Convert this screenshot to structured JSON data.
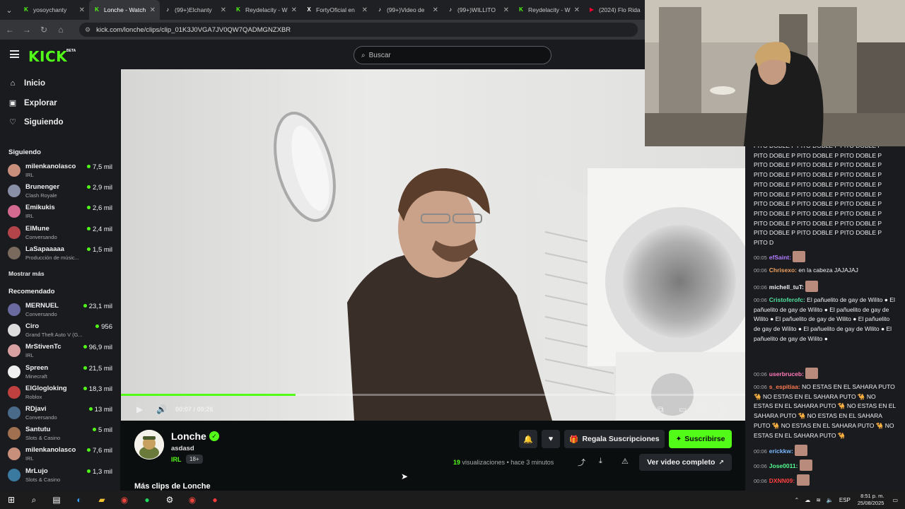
{
  "browser": {
    "tabs": [
      {
        "title": "yosoychanty",
        "fav": "K",
        "fav_color": "#53fc18",
        "active": false
      },
      {
        "title": "Lonche - Watch",
        "fav": "K",
        "fav_color": "#53fc18",
        "active": true
      },
      {
        "title": "(99+)Elchanty",
        "fav": "♪",
        "fav_color": "#ffffff",
        "active": false
      },
      {
        "title": "Reydelacity - W",
        "fav": "K",
        "fav_color": "#53fc18",
        "active": false
      },
      {
        "title": "FortyOficial en",
        "fav": "X",
        "fav_color": "#ffffff",
        "active": false
      },
      {
        "title": "(99+)Video de",
        "fav": "♪",
        "fav_color": "#ffffff",
        "active": false
      },
      {
        "title": "(99+)WILLITO",
        "fav": "♪",
        "fav_color": "#ffffff",
        "active": false
      },
      {
        "title": "Reydelacity - W",
        "fav": "K",
        "fav_color": "#53fc18",
        "active": false
      },
      {
        "title": "(2024) Flo Rida",
        "fav": "▶",
        "fav_color": "#ff0033",
        "active": false
      }
    ],
    "url": "kick.com/lonche/clips/clip_01K3J0VGA7JV0QW7QADMGNZXBR"
  },
  "header": {
    "logo": "KICK",
    "logo_badge": "BETA",
    "search_placeholder": "Buscar"
  },
  "sidebar": {
    "nav": [
      {
        "label": "Inicio",
        "icon": "home-icon",
        "glyph": "⌂"
      },
      {
        "label": "Explorar",
        "icon": "explore-icon",
        "glyph": "▣"
      },
      {
        "label": "Siguiendo",
        "icon": "heart-icon",
        "glyph": "♡"
      }
    ],
    "following_title": "Siguiendo",
    "following": [
      {
        "name": "milenkanolasco",
        "category": "IRL",
        "viewers": "7,5 mil",
        "color": "#c88f7a"
      },
      {
        "name": "Brunenger",
        "category": "Clash Royale",
        "viewers": "2,9 mil",
        "color": "#8a8fa8"
      },
      {
        "name": "Emikukis",
        "category": "IRL",
        "viewers": "2,6 mil",
        "color": "#d46a8f"
      },
      {
        "name": "ElMune",
        "category": "Conversando",
        "viewers": "2,4 mil",
        "color": "#b3454a"
      },
      {
        "name": "LaSapaaaaa",
        "category": "Producción de músic...",
        "viewers": "1,5 mil",
        "color": "#7a6a5e"
      }
    ],
    "show_more": "Mostrar más",
    "recommended_title": "Recomendado",
    "recommended": [
      {
        "name": "MERNUEL",
        "category": "Conversando",
        "viewers": "23,1 mil",
        "color": "#6a6aa0"
      },
      {
        "name": "Ciro",
        "category": "Grand Theft Auto V (G...",
        "viewers": "956",
        "color": "#dcdcdc"
      },
      {
        "name": "MrStivenTc",
        "category": "IRL",
        "viewers": "96,9 mil",
        "color": "#d8a0a0"
      },
      {
        "name": "Spreen",
        "category": "Minecraft",
        "viewers": "21,5 mil",
        "color": "#f0f0f0"
      },
      {
        "name": "ElGlogloking",
        "category": "Roblox",
        "viewers": "18,3 mil",
        "color": "#c04040"
      },
      {
        "name": "RDjavi",
        "category": "Conversando",
        "viewers": "13 mil",
        "color": "#4a6a8a"
      },
      {
        "name": "Santutu",
        "category": "Slots & Casino",
        "viewers": "5 mil",
        "color": "#a07050"
      },
      {
        "name": "milenkanolasco",
        "category": "IRL",
        "viewers": "7,6 mil",
        "color": "#c88f7a"
      },
      {
        "name": "MrLujo",
        "category": "Slots & Casino",
        "viewers": "1,3 mil",
        "color": "#3a7aa0"
      }
    ]
  },
  "player": {
    "time": "00:07 / 00:26",
    "progress_fraction": 0.28
  },
  "clip": {
    "channel": "Lonche",
    "title": "asdasd",
    "category": "IRL",
    "age_badge": "18+",
    "gift_label": "Regala Suscripciones",
    "subscribe_label": "Suscribirse",
    "views_count": "19",
    "views_label": "visualizaciones",
    "time_ago": "hace 3 minutos",
    "full_video_label": "Ver video completo",
    "more_clips": "Más clips de Lonche"
  },
  "chat": {
    "spam_text": "PITO DOBLE P PITO DOBLE P PITO DOBLE P PITO DOBLE P PITO DOBLE P PITO DOBLE P PITO DOBLE P PITO DOBLE P PITO DOBLE P PITO DOBLE P PITO DOBLE P PITO DOBLE P PITO DOBLE P PITO DOBLE P PITO DOBLE P PITO DOBLE P PITO DOBLE P PITO DOBLE P PITO DOBLE P PITO DOBLE P PITO DOBLE P PITO DOBLE P PITO DOBLE P PITO DOBLE P PITO DOBLE P PITO DOBLE P PITO DOBLE P PITO DOBLE P PITO DOBLE P PITO DOBLE P PITO D",
    "messages": [
      {
        "ts": "00:05",
        "user": "efSaint:",
        "color": "#b27cff",
        "text": ""
      },
      {
        "ts": "00:06",
        "user": "Chrisexo:",
        "color": "#f0a060",
        "text": " en la cabeza JAJAJAJ"
      },
      {
        "ts": "00:06",
        "user": "michell_tuT:",
        "color": "#f0f0f0",
        "text": ""
      },
      {
        "ts": "00:06",
        "user": "Cristoferofc:",
        "color": "#53e0a0",
        "text": " El pañuelito de gay de Wilito ● El pañuelito de gay de Wilito ● El pañuelito de gay de Wilito ● El pañuelito de gay de Wilito ● El pañuelito de gay de Wilito ● El pañuelito de gay de Wilito ● El pañuelito de gay de Wilito ●"
      },
      {
        "ts": "00:06",
        "user": "userbruceb:",
        "color": "#ff7ab8",
        "text": ""
      },
      {
        "ts": "00:06",
        "user": "s_espitiaa:",
        "color": "#ff7a50",
        "text": " NO ESTAS EN EL SAHARA PUTO 🐪 NO ESTAS EN EL SAHARA PUTO 🐪 NO ESTAS EN EL SAHARA PUTO 🐪 NO ESTAS EN EL SAHARA PUTO 🐪 NO ESTAS EN EL SAHARA PUTO 🐪 NO ESTAS EN EL SAHARA PUTO 🐪 NO ESTAS EN EL SAHARA PUTO 🐪"
      },
      {
        "ts": "00:06",
        "user": "erickkw:",
        "color": "#7ab8ff",
        "text": ""
      },
      {
        "ts": "00:06",
        "user": "Jose0011:",
        "color": "#53fc90",
        "text": ""
      },
      {
        "ts": "00:06",
        "user": "DXNN09:",
        "color": "#ff4040",
        "text": ""
      }
    ]
  },
  "taskbar": {
    "lang": "ESP",
    "time": "8:51 p. m.",
    "date": "25/08/2025"
  }
}
